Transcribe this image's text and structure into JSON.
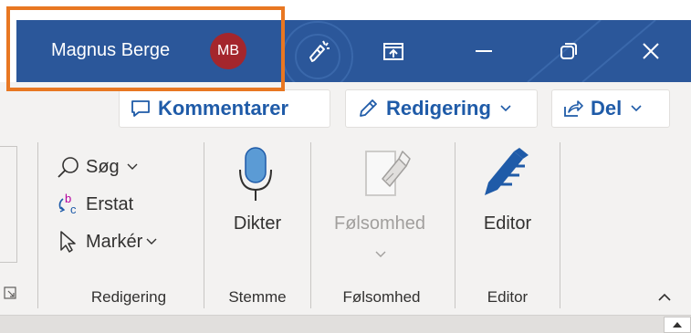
{
  "titlebar": {
    "user_name": "Magnus Berge",
    "avatar_initials": "MB",
    "icons": [
      "draw-pen-icon",
      "ribbon-display-options-icon",
      "minimize-icon",
      "restore-icon",
      "close-icon"
    ]
  },
  "ribbon": {
    "top_actions": {
      "comments_label": "Kommentarer",
      "editing_label": "Redigering",
      "share_label": "Del"
    },
    "editing_group": {
      "find_label": "Søg",
      "replace_label": "Erstat",
      "select_label": "Markér",
      "group_label": "Redigering"
    },
    "voice_group": {
      "dictate_label": "Dikter",
      "group_label": "Stemme"
    },
    "sensitivity_group": {
      "sensitivity_label": "Følsomhed",
      "group_label": "Følsomhed"
    },
    "editor_group": {
      "editor_label": "Editor",
      "group_label": "Editor"
    }
  },
  "colors": {
    "titlebar_blue": "#2b579a",
    "avatar_red": "#a4262c",
    "highlight_orange": "#e87722",
    "accent_blue": "#1f5ba8"
  }
}
